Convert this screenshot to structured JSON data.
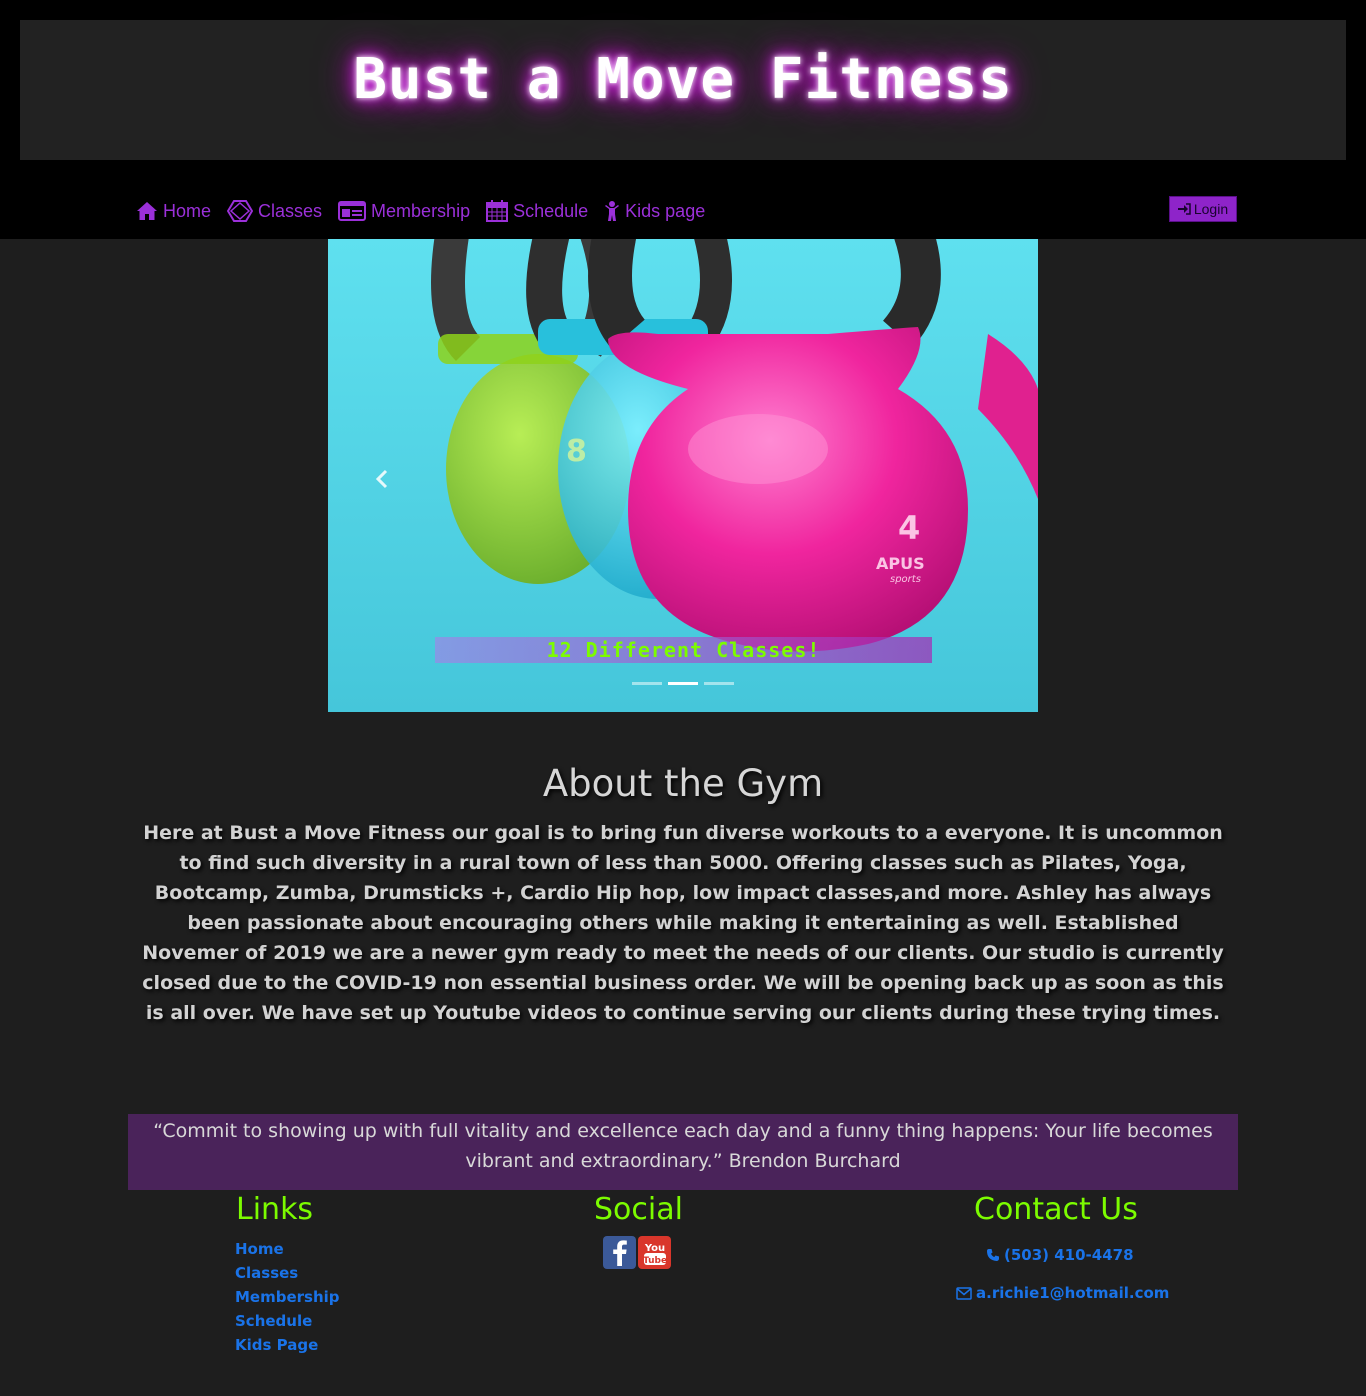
{
  "site": {
    "title": "Bust a Move Fitness"
  },
  "nav": {
    "items": [
      {
        "label": "Home",
        "icon": "home-icon"
      },
      {
        "label": "Classes",
        "icon": "classes-icon"
      },
      {
        "label": "Membership",
        "icon": "id-card-icon"
      },
      {
        "label": "Schedule",
        "icon": "calendar-icon"
      },
      {
        "label": "Kids page",
        "icon": "child-icon"
      }
    ],
    "login_label": "Login"
  },
  "carousel": {
    "caption": "12 Different Classes!",
    "slide_count": 3,
    "active_slide": 2,
    "kettlebell_numbers": [
      "8",
      "4"
    ],
    "kettlebell_brand": "APUS",
    "kettlebell_subbrand": "sports"
  },
  "about": {
    "title": "About the Gym",
    "text": "Here at Bust a Move Fitness our goal is to bring fun diverse workouts to a everyone. It is uncommon to find such diversity in a rural town of less than 5000. Offering classes such as Pilates, Yoga, Bootcamp, Zumba, Drumsticks +, Cardio Hip hop, low impact classes,and more. Ashley has always been passionate about encouraging others while making it entertaining as well. Established Novemer of 2019 we are a newer gym ready to meet the needs of our clients. Our studio is currently closed due to the COVID-19 non essential business order. We will be opening back up as soon as this is all over. We have set up Youtube videos to continue serving our clients during these trying times."
  },
  "quote": {
    "text": "“Commit to showing up with full vitality and excellence each day and a funny thing happens: Your life becomes vibrant and extraordinary.” Brendon Burchard"
  },
  "footer": {
    "links_heading": "Links",
    "links": [
      "Home",
      "Classes",
      "Membership",
      "Schedule",
      "Kids Page"
    ],
    "social_heading": "Social",
    "social_icons": [
      "facebook-icon",
      "youtube-icon"
    ],
    "youtube_label": [
      "You",
      "Tube"
    ],
    "contact_heading": "Contact Us",
    "phone": "(503) 410-4478",
    "email": "a.richie1@hotmail.com"
  },
  "colors": {
    "accent": "#9b30d9",
    "heading_green": "#7cfc00",
    "link_blue": "#1a73e8",
    "quote_bg": "#4a235a",
    "page_bg": "#1e1e1e"
  }
}
